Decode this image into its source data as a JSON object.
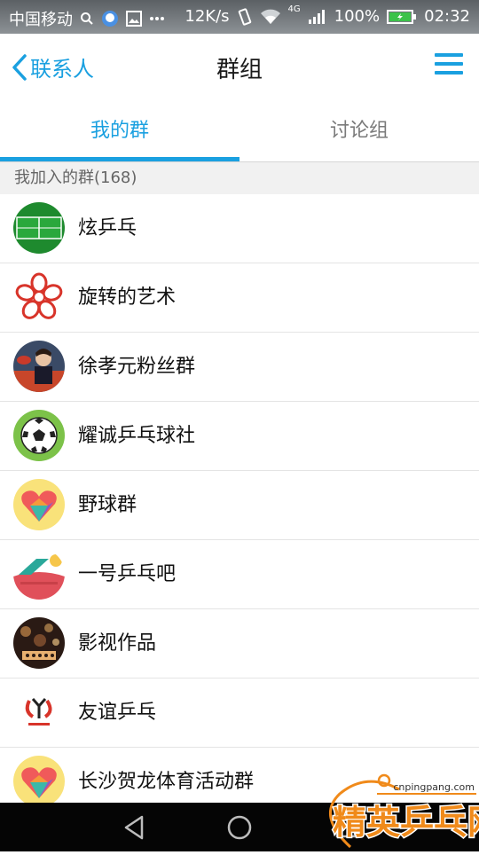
{
  "status_bar": {
    "carrier": "中国移动",
    "speed": "12K/s",
    "network": "4G",
    "battery": "100%",
    "time": "02:32"
  },
  "header": {
    "back_label": "联系人",
    "title": "群组"
  },
  "tabs": [
    {
      "label": "我的群",
      "active": true
    },
    {
      "label": "讨论组",
      "active": false
    }
  ],
  "section_header": "我加入的群(168)",
  "groups": [
    {
      "name": "炫乒乓",
      "icon": "table-tennis-table-avatar"
    },
    {
      "name": "旋转的艺术",
      "icon": "flower-avatar"
    },
    {
      "name": "徐孝元粉丝群",
      "icon": "player-photo-avatar"
    },
    {
      "name": "耀诚乒乓球社",
      "icon": "soccer-ball-avatar"
    },
    {
      "name": "野球群",
      "icon": "heart-avatar"
    },
    {
      "name": "一号乒乓吧",
      "icon": "paddle-avatar"
    },
    {
      "name": "影视作品",
      "icon": "bokeh-photo-avatar"
    },
    {
      "name": "友谊乒乓",
      "icon": "club-logo-avatar"
    },
    {
      "name": "长沙贺龙体育活动群",
      "icon": "heart-avatar"
    }
  ],
  "watermark": {
    "url": "cnpingpang.com",
    "brand": "精英乒乓网"
  },
  "colors": {
    "accent": "#1aa0e0",
    "status_bar": "#6f7478",
    "nav_bar": "#050505",
    "section_bg": "#f1f1f1"
  }
}
